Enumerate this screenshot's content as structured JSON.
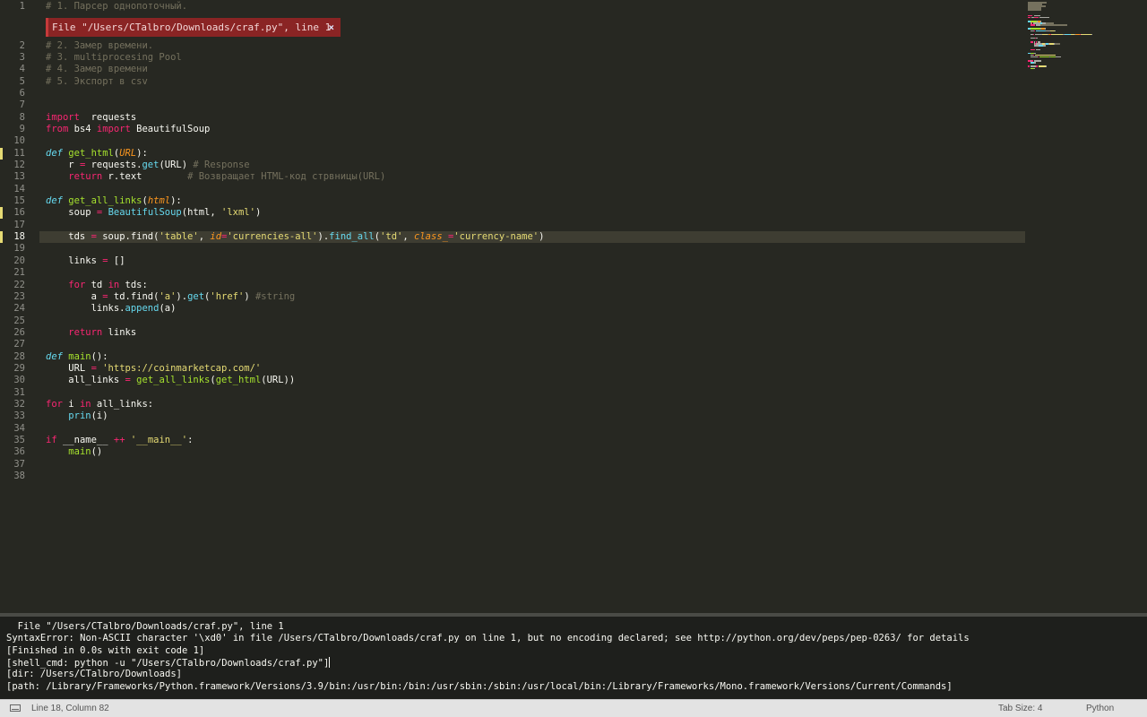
{
  "editor": {
    "current_line": 18,
    "modified_lines": [
      11,
      16,
      18
    ],
    "lines": [
      {
        "n": "1",
        "t": [
          [
            "c",
            "# 1. Парсер однопоточный."
          ]
        ]
      },
      {
        "n": "2",
        "t": [
          [
            "c",
            "# 2. Замер времени."
          ]
        ]
      },
      {
        "n": "3",
        "t": [
          [
            "c",
            "# 3. multiprocesing Pool"
          ]
        ]
      },
      {
        "n": "4",
        "t": [
          [
            "c",
            "# 4. Замер времени"
          ]
        ]
      },
      {
        "n": "5",
        "t": [
          [
            "c",
            "# 5. Экспорт в csv"
          ]
        ]
      },
      {
        "n": "6",
        "t": []
      },
      {
        "n": "7",
        "t": []
      },
      {
        "n": "8",
        "t": [
          [
            "k",
            "import"
          ],
          [
            "",
            "  requests"
          ]
        ]
      },
      {
        "n": "9",
        "t": [
          [
            "k",
            "from"
          ],
          [
            "",
            " bs4 "
          ],
          [
            "k",
            "import"
          ],
          [
            "",
            " BeautifulSoup"
          ]
        ]
      },
      {
        "n": "10",
        "t": []
      },
      {
        "n": "11",
        "t": [
          [
            "d",
            "def"
          ],
          [
            "",
            " "
          ],
          [
            "f",
            "get_html"
          ],
          [
            "",
            "("
          ],
          [
            "p",
            "URL"
          ],
          [
            "",
            "):"
          ]
        ]
      },
      {
        "n": "12",
        "t": [
          [
            "",
            "    r "
          ],
          [
            "k",
            "="
          ],
          [
            "",
            " requests."
          ],
          [
            "b",
            "get"
          ],
          [
            "",
            "(URL) "
          ],
          [
            "c",
            "# Response"
          ]
        ]
      },
      {
        "n": "13",
        "t": [
          [
            "",
            "    "
          ],
          [
            "k",
            "return"
          ],
          [
            "",
            " r.text        "
          ],
          [
            "c",
            "# Возвращает HTML-код стрвницы(URL)"
          ]
        ]
      },
      {
        "n": "14",
        "t": []
      },
      {
        "n": "15",
        "t": [
          [
            "d",
            "def"
          ],
          [
            "",
            " "
          ],
          [
            "f",
            "get_all_links"
          ],
          [
            "",
            "("
          ],
          [
            "p",
            "html"
          ],
          [
            "",
            "):"
          ]
        ]
      },
      {
        "n": "16",
        "t": [
          [
            "",
            "    soup "
          ],
          [
            "k",
            "="
          ],
          [
            "",
            " "
          ],
          [
            "b",
            "BeautifulSoup"
          ],
          [
            "",
            "(html, "
          ],
          [
            "s",
            "'lxml'"
          ],
          [
            "",
            ")"
          ]
        ]
      },
      {
        "n": "17",
        "t": []
      },
      {
        "n": "18",
        "t": [
          [
            "",
            "    tds "
          ],
          [
            "k",
            "="
          ],
          [
            "",
            " soup.find("
          ],
          [
            "s",
            "'table'"
          ],
          [
            "",
            ", "
          ],
          [
            "p",
            "id"
          ],
          [
            "k",
            "="
          ],
          [
            "s",
            "'currencies-all'"
          ],
          [
            "",
            ")."
          ],
          [
            "b",
            "find_all"
          ],
          [
            "",
            "("
          ],
          [
            "s",
            "'td'"
          ],
          [
            "",
            ", "
          ],
          [
            "p",
            "class_"
          ],
          [
            "k",
            "="
          ],
          [
            "s",
            "'currency-name'"
          ],
          [
            "",
            ")"
          ]
        ]
      },
      {
        "n": "19",
        "t": []
      },
      {
        "n": "20",
        "t": [
          [
            "",
            "    links "
          ],
          [
            "k",
            "="
          ],
          [
            "",
            " []"
          ]
        ]
      },
      {
        "n": "21",
        "t": []
      },
      {
        "n": "22",
        "t": [
          [
            "",
            "    "
          ],
          [
            "k",
            "for"
          ],
          [
            "",
            " td "
          ],
          [
            "k",
            "in"
          ],
          [
            "",
            " tds:"
          ]
        ]
      },
      {
        "n": "23",
        "t": [
          [
            "",
            "        a "
          ],
          [
            "k",
            "="
          ],
          [
            "",
            " td.find("
          ],
          [
            "s",
            "'a'"
          ],
          [
            "",
            ")."
          ],
          [
            "b",
            "get"
          ],
          [
            "",
            "("
          ],
          [
            "s",
            "'href'"
          ],
          [
            "",
            ") "
          ],
          [
            "c",
            "#string"
          ]
        ]
      },
      {
        "n": "24",
        "t": [
          [
            "",
            "        links."
          ],
          [
            "b",
            "append"
          ],
          [
            "",
            "(a)"
          ]
        ]
      },
      {
        "n": "25",
        "t": []
      },
      {
        "n": "26",
        "t": [
          [
            "",
            "    "
          ],
          [
            "k",
            "return"
          ],
          [
            "",
            " links"
          ]
        ]
      },
      {
        "n": "27",
        "t": []
      },
      {
        "n": "28",
        "t": [
          [
            "d",
            "def"
          ],
          [
            "",
            " "
          ],
          [
            "f",
            "main"
          ],
          [
            "",
            "():"
          ]
        ]
      },
      {
        "n": "29",
        "t": [
          [
            "",
            "    URL "
          ],
          [
            "k",
            "="
          ],
          [
            "",
            " "
          ],
          [
            "s",
            "'https://coinmarketcap.com/'"
          ]
        ]
      },
      {
        "n": "30",
        "t": [
          [
            "",
            "    all_links "
          ],
          [
            "k",
            "="
          ],
          [
            "",
            " "
          ],
          [
            "f",
            "get_all_links"
          ],
          [
            "",
            "("
          ],
          [
            "f",
            "get_html"
          ],
          [
            "",
            "(URL))"
          ]
        ]
      },
      {
        "n": "31",
        "t": []
      },
      {
        "n": "32",
        "t": [
          [
            "k",
            "for"
          ],
          [
            "",
            " i "
          ],
          [
            "k",
            "in"
          ],
          [
            "",
            " all_links:"
          ]
        ]
      },
      {
        "n": "33",
        "t": [
          [
            "",
            "    "
          ],
          [
            "b",
            "prin"
          ],
          [
            "",
            "(i)"
          ]
        ]
      },
      {
        "n": "34",
        "t": []
      },
      {
        "n": "35",
        "t": [
          [
            "k",
            "if"
          ],
          [
            "",
            " __name__ "
          ],
          [
            "k",
            "++"
          ],
          [
            "",
            " "
          ],
          [
            "s",
            "'__main__'"
          ],
          [
            "",
            ":"
          ]
        ]
      },
      {
        "n": "36",
        "t": [
          [
            "",
            "    "
          ],
          [
            "f",
            "main"
          ],
          [
            "",
            "()"
          ]
        ]
      },
      {
        "n": "37",
        "t": []
      },
      {
        "n": "38",
        "t": []
      }
    ]
  },
  "error_phantom": {
    "text": "File \"/Users/CTalbro/Downloads/craf.py\", line 1",
    "close": "×"
  },
  "build_output": {
    "lines": [
      "  File \"/Users/CTalbro/Downloads/craf.py\", line 1",
      "SyntaxError: Non-ASCII character '\\xd0' in file /Users/CTalbro/Downloads/craf.py on line 1, but no encoding declared; see http://python.org/dev/peps/pep-0263/ for details",
      "[Finished in 0.0s with exit code 1]",
      "[shell_cmd: python -u \"/Users/CTalbro/Downloads/craf.py\"]",
      "[dir: /Users/CTalbro/Downloads]",
      "[path: /Library/Frameworks/Python.framework/Versions/3.9/bin:/usr/bin:/bin:/usr/sbin:/sbin:/usr/local/bin:/Library/Frameworks/Mono.framework/Versions/Current/Commands]"
    ],
    "caret_line": 3
  },
  "status_bar": {
    "position": "Line 18, Column 82",
    "tab_size": "Tab Size: 4",
    "syntax": "Python"
  },
  "colors": {
    "background": "#272822",
    "comment": "#75715e",
    "keyword": "#f92672",
    "string": "#e6db74",
    "function": "#a6e22e",
    "builtin": "#66d9ef",
    "param": "#fd971f",
    "error_phantom": "#8a2424"
  }
}
